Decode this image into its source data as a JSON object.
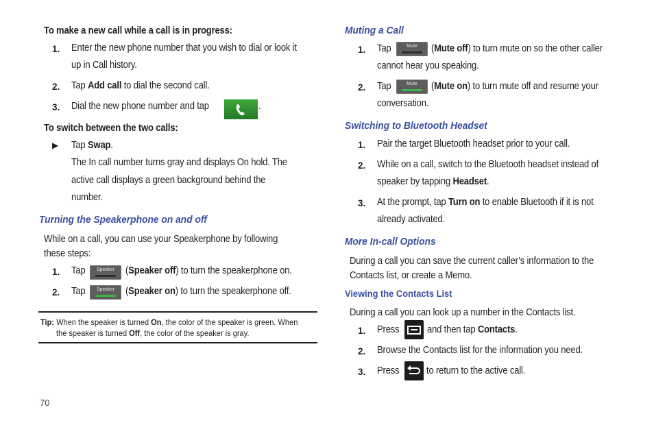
{
  "page_number": "70",
  "left": {
    "new_call": {
      "heading": "To make a new call while a call is in progress:",
      "steps": [
        {
          "num": "1.",
          "line1": "Enter the new phone number that you wish to dial or look it",
          "line2": "up in Call history."
        },
        {
          "num": "2.",
          "pre": "Tap ",
          "bold": "Add call",
          "post": " to dial the second call."
        },
        {
          "num": "3.",
          "pre": "Dial the new phone number and tap",
          "post": "."
        }
      ],
      "call_icon": "phone-icon"
    },
    "switch_calls": {
      "heading": "To switch between the two calls:",
      "bullet": "▶",
      "pre": "Tap ",
      "bold": "Swap",
      "post": ".",
      "desc": [
        "The In call number turns gray and displays On hold. The",
        "active call displays a green background behind the",
        "number."
      ]
    },
    "speakerphone": {
      "heading": "Turning the Speakerphone on and off",
      "intro": [
        "While on a call, you can use your Speakerphone by following",
        "these steps:"
      ],
      "button_label": "Speaker",
      "steps": [
        {
          "num": "1.",
          "pre": "Tap",
          "paren_open": "(",
          "bold": "Speaker off",
          "post": ") to turn the speakerphone on.",
          "state": "off"
        },
        {
          "num": "2.",
          "pre": "Tap",
          "paren_open": "(",
          "bold": "Speaker on",
          "post": ") to turn the speakerphone off.",
          "state": "on"
        }
      ]
    },
    "tip": {
      "label": "Tip:",
      "l1_pre": " When the speaker is turned ",
      "l1_bold": "On",
      "l1_post": ", the color of the speaker is green. When",
      "l2_pre": "the speaker is turned ",
      "l2_bold": "Off",
      "l2_post": ", the color of the speaker is gray."
    }
  },
  "right": {
    "muting": {
      "heading": "Muting a Call",
      "button_label": "Mute",
      "steps": [
        {
          "num": "1.",
          "pre": "Tap",
          "paren_open": "(",
          "bold": "Mute off",
          "post": ") to turn mute on so the other caller",
          "line2": "cannot hear you speaking.",
          "state": "off"
        },
        {
          "num": "2.",
          "pre": "Tap",
          "paren_open": "(",
          "bold": "Mute on",
          "post": ") to turn mute off and resume your",
          "line2": "conversation.",
          "state": "on"
        }
      ]
    },
    "bluetooth": {
      "heading": "Switching to Bluetooth Headset",
      "steps": [
        {
          "num": "1.",
          "text": "Pair the target Bluetooth headset prior to your call."
        },
        {
          "num": "2.",
          "line1": "While on a call, switch to the Bluetooth headset instead of",
          "pre": "speaker by tapping ",
          "bold": "Headset",
          "post": "."
        },
        {
          "num": "3.",
          "pre": "At the prompt, tap ",
          "bold": "Turn on",
          "post": " to enable Bluetooth if it is not",
          "line2": "already activated."
        }
      ]
    },
    "more_options": {
      "heading": "More In-call Options",
      "text": [
        "During a call you can save the current caller’s information to the",
        "Contacts list, or create a Memo."
      ]
    },
    "contacts": {
      "heading": "Viewing the Contacts List",
      "intro": "During a call you can look up a number in the Contacts list.",
      "steps": [
        {
          "num": "1.",
          "pre": "Press",
          "mid": "and then tap ",
          "bold": "Contacts",
          "post": ".",
          "icon": "menu-key-icon"
        },
        {
          "num": "2.",
          "text": "Browse the Contacts list for the information you need."
        },
        {
          "num": "3.",
          "pre": "Press",
          "post": "to return to the active call.",
          "icon": "back-key-icon"
        }
      ]
    }
  }
}
